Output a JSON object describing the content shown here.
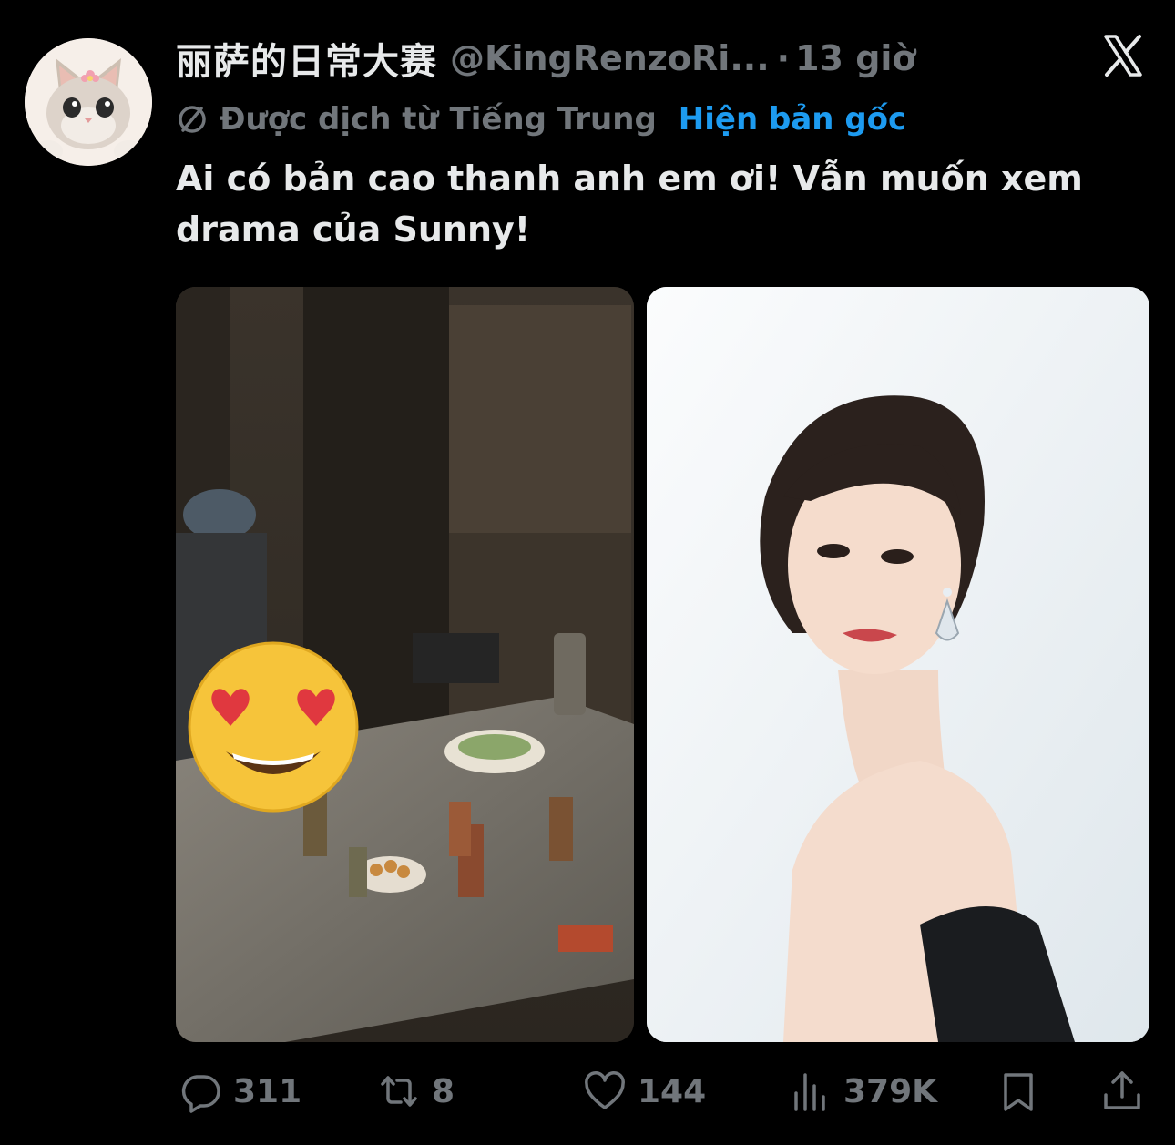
{
  "tweet": {
    "display_name": "丽萨的日常大赛",
    "handle": "@KingRenzoRi...",
    "separator": "·",
    "time": "13 giờ",
    "translated_from": "Được dịch từ Tiếng Trung",
    "show_original": "Hiện bản gốc",
    "text": "Ai có bản cao thanh anh em ơi! Vẫn muốn xem drama của Sunny!"
  },
  "actions": {
    "replies": "311",
    "retweets": "8",
    "likes": "144",
    "views": "379K"
  },
  "icons": {
    "logo": "x-logo-icon",
    "translate": "translate-icon",
    "reply": "reply-icon",
    "retweet": "retweet-icon",
    "like": "heart-icon",
    "views": "views-icon",
    "bookmark": "bookmark-icon",
    "share": "share-icon"
  },
  "colors": {
    "background": "#000000",
    "text_primary": "#e7e9ea",
    "text_secondary": "#71767b",
    "link": "#1d9bf0"
  }
}
